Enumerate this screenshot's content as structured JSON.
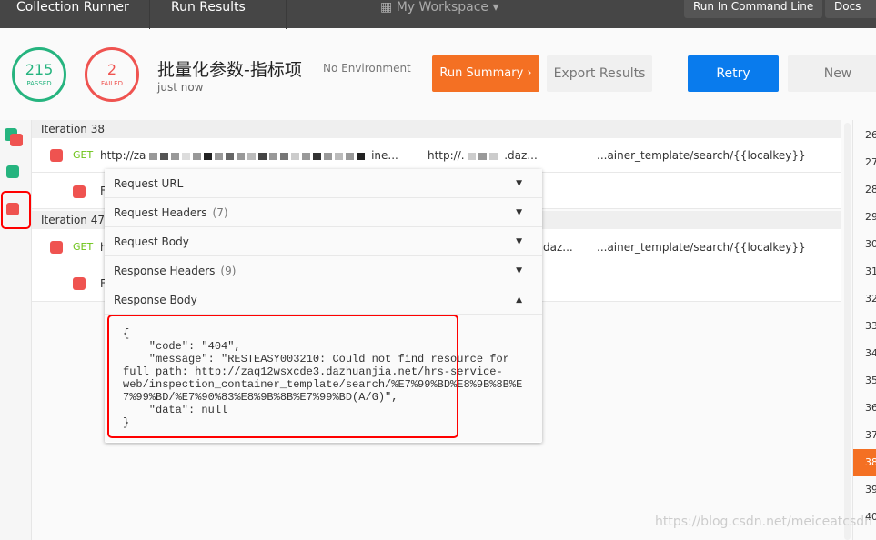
{
  "header": {
    "crumbs": [
      "Collection Runner",
      "Run Results"
    ],
    "workspace": "My Workspace",
    "run_cli": "Run In Command Line",
    "docs": "Docs"
  },
  "summary": {
    "passed": "215",
    "passed_label": "PASSED",
    "failed": "2",
    "failed_label": "FAILED",
    "title": "批量化参数-指标项",
    "environment": "No Environment",
    "time": "just now",
    "run_summary": "Run Summary",
    "export": "Export Results",
    "retry": "Retry",
    "new": "New"
  },
  "colors": {
    "passed": "#26b47f",
    "failed": "#ef5350",
    "accent": "#f47023",
    "retry": "#097bed"
  },
  "iterations": [
    {
      "label": "Iteration 38",
      "method": "GET",
      "url_start": "http://za",
      "url_mid": "ine...",
      "url2": "http://.",
      "url2_end": ".daz...",
      "path": "...ainer_template/search/{{localkey}}",
      "sub": "F"
    },
    {
      "label": "Iteration 47",
      "method": "GET",
      "url_start": "h",
      "url2_end": "daz...",
      "path": "...ainer_template/search/{{localkey}}",
      "sub": "F"
    }
  ],
  "popover": {
    "items": [
      {
        "label": "Request URL",
        "count": ""
      },
      {
        "label": "Request Headers",
        "count": "(7)"
      },
      {
        "label": "Request Body",
        "count": ""
      },
      {
        "label": "Response Headers",
        "count": "(9)"
      },
      {
        "label": "Response Body",
        "count": ""
      }
    ],
    "body": "{\n    \"code\": \"404\",\n    \"message\": \"RESTEASY003210: Could not find resource for\nfull path: http://zaq12wsxcde3.dazhuanjia.net/hrs-service-\nweb/inspection_container_template/search/%E7%99%BD%E8%9B%8B%E\n7%99%BD/%E7%90%83%E8%9B%8B%E7%99%BD(A/G)\",\n    \"data\": null\n}"
  },
  "iteration_numbers": [
    "26",
    "27",
    "28",
    "29",
    "30",
    "31",
    "32",
    "33",
    "34",
    "35",
    "36",
    "37",
    "38",
    "39",
    "40"
  ],
  "active_iteration": "38",
  "watermark": "https://blog.csdn.net/meiceatcsdn"
}
